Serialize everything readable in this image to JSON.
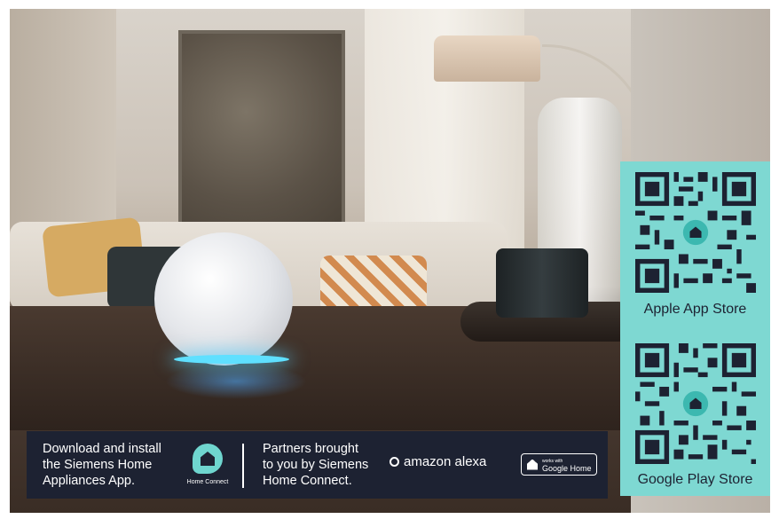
{
  "info_bar": {
    "download_text": "Download and install\nthe Siemens Home\nAppliances App.",
    "home_connect_label": "Home Connect",
    "partners_text": "Partners brought\nto you by Siemens\nHome Connect.",
    "alexa_label": "amazon alexa",
    "google_small": "works with",
    "google_big": "Google Home"
  },
  "qr_panel": {
    "apple_label": "Apple App Store",
    "google_label": "Google Play Store"
  },
  "colors": {
    "bar_bg": "#1d2232",
    "accent_teal": "#7ed8d2"
  },
  "icons": [
    "home-connect-icon",
    "alexa-icon",
    "google-home-icon",
    "qr-code-icon"
  ]
}
